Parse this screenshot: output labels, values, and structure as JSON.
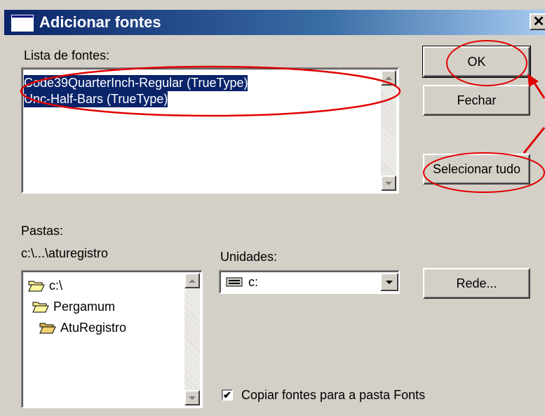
{
  "window": {
    "title": "Adicionar fontes",
    "close_label": "✕"
  },
  "font_list": {
    "label": "Lista de fontes:",
    "items": [
      {
        "label": "Code39QuarterInch-Regular (TrueType)",
        "selected": true
      },
      {
        "label": "Unc-Half-Bars (TrueType)",
        "selected": true
      }
    ]
  },
  "buttons": {
    "ok": "OK",
    "close": "Fechar",
    "select_all": "Selecionar tudo",
    "network": "Rede..."
  },
  "folders": {
    "label": "Pastas:",
    "current_path": "c:\\...\\aturegistro",
    "items": [
      {
        "label": "c:\\",
        "icon": "open-folder-icon"
      },
      {
        "label": "Pergamum",
        "icon": "open-folder-icon"
      },
      {
        "label": "AtuRegistro",
        "icon": "open-folder-icon"
      }
    ]
  },
  "drives": {
    "label": "Unidades:",
    "selected": "c:",
    "icon": "drive-icon"
  },
  "copy_option": {
    "label": "Copiar fontes para a pasta Fonts",
    "checked": true,
    "check_mark": "✔"
  },
  "colors": {
    "annotation": "#e00000",
    "selection": "#0a246a",
    "dialog": "#d4d0c8"
  }
}
